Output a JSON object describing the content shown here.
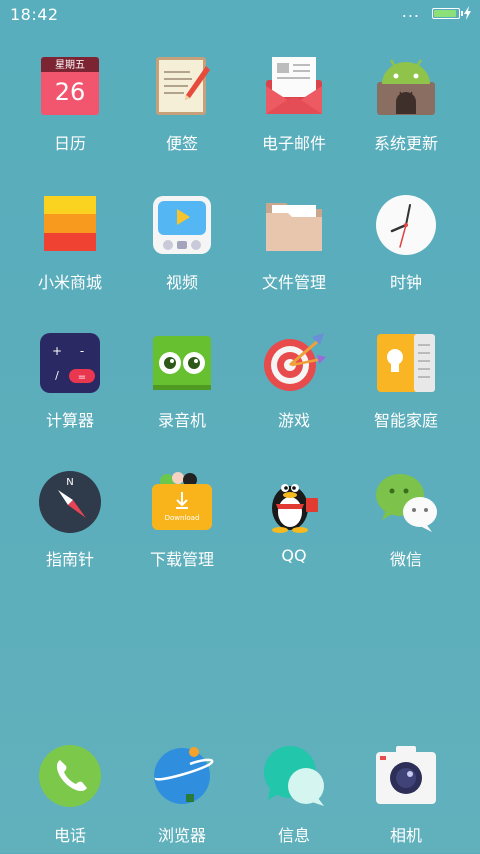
{
  "status": {
    "time": "18:42",
    "dots": "...",
    "battery_level": 0.85
  },
  "apps": [
    {
      "label": "日历",
      "icon": "calendar-icon",
      "weekday": "星期五",
      "day": "26"
    },
    {
      "label": "便签",
      "icon": "notes-icon"
    },
    {
      "label": "电子邮件",
      "icon": "email-icon"
    },
    {
      "label": "系统更新",
      "icon": "system-update-icon"
    },
    {
      "label": "小米商城",
      "icon": "mi-store-icon"
    },
    {
      "label": "视频",
      "icon": "video-icon"
    },
    {
      "label": "文件管理",
      "icon": "folder-icon"
    },
    {
      "label": "时钟",
      "icon": "clock-icon"
    },
    {
      "label": "计算器",
      "icon": "calculator-icon"
    },
    {
      "label": "录音机",
      "icon": "recorder-icon"
    },
    {
      "label": "游戏",
      "icon": "game-target-icon"
    },
    {
      "label": "智能家庭",
      "icon": "smart-home-icon"
    },
    {
      "label": "指南针",
      "icon": "compass-icon",
      "north": "N"
    },
    {
      "label": "下载管理",
      "icon": "download-icon",
      "badge": "Download"
    },
    {
      "label": "QQ",
      "icon": "qq-penguin-icon"
    },
    {
      "label": "微信",
      "icon": "wechat-icon"
    }
  ],
  "dock": [
    {
      "label": "电话",
      "icon": "phone-icon"
    },
    {
      "label": "浏览器",
      "icon": "browser-planet-icon"
    },
    {
      "label": "信息",
      "icon": "messages-icon"
    },
    {
      "label": "相机",
      "icon": "camera-icon"
    }
  ],
  "colors": {
    "wallpaper": "#5badbb",
    "battery": "#8ce07a"
  }
}
